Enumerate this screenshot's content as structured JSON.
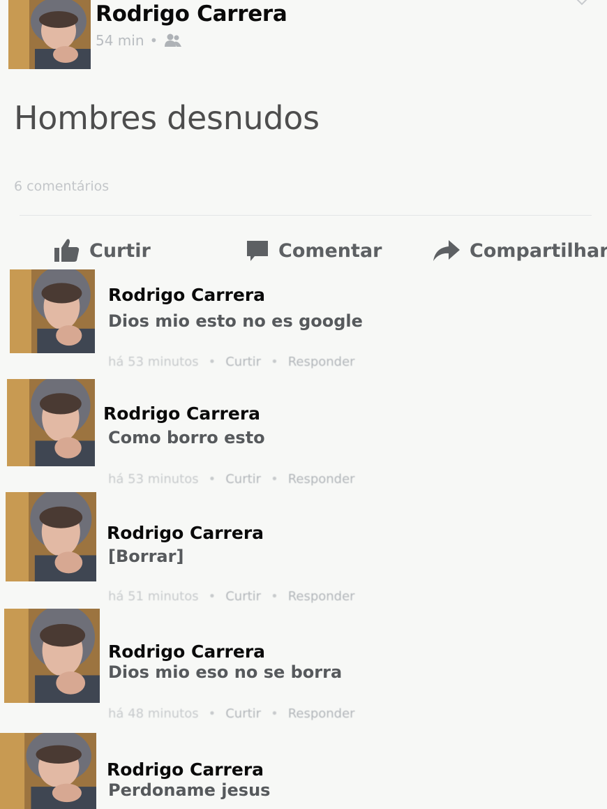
{
  "post": {
    "author": "Rodrigo Carrera",
    "time": "54 min",
    "separator": "•",
    "audience_icon": "friends-icon",
    "text": "Hombres desnudos",
    "comments_count": "6 comentários"
  },
  "actions": {
    "like": "Curtir",
    "comment": "Comentar",
    "share": "Compartilhar"
  },
  "comments": [
    {
      "author": "Rodrigo Carrera",
      "text": "Dios mio esto no es google",
      "time": "há 53 minutos",
      "like": "Curtir",
      "reply": "Responder"
    },
    {
      "author": "Rodrigo Carrera",
      "text": "Como borro esto",
      "time": "há 53 minutos",
      "like": "Curtir",
      "reply": "Responder"
    },
    {
      "author": "Rodrigo Carrera",
      "text": "[Borrar]",
      "time": "há 51 minutos",
      "like": "Curtir",
      "reply": "Responder"
    },
    {
      "author": "Rodrigo Carrera",
      "text": "Dios mio eso no se borra",
      "time": "há 48 minutos",
      "like": "Curtir",
      "reply": "Responder"
    },
    {
      "author": "Rodrigo Carrera",
      "text": "Perdoname jesus"
    }
  ],
  "meta_separator": "•",
  "colors": {
    "background": "#f7f8f6",
    "name": "#0a0a0a",
    "action": "#5d6063",
    "muted": "#c7cacc"
  }
}
